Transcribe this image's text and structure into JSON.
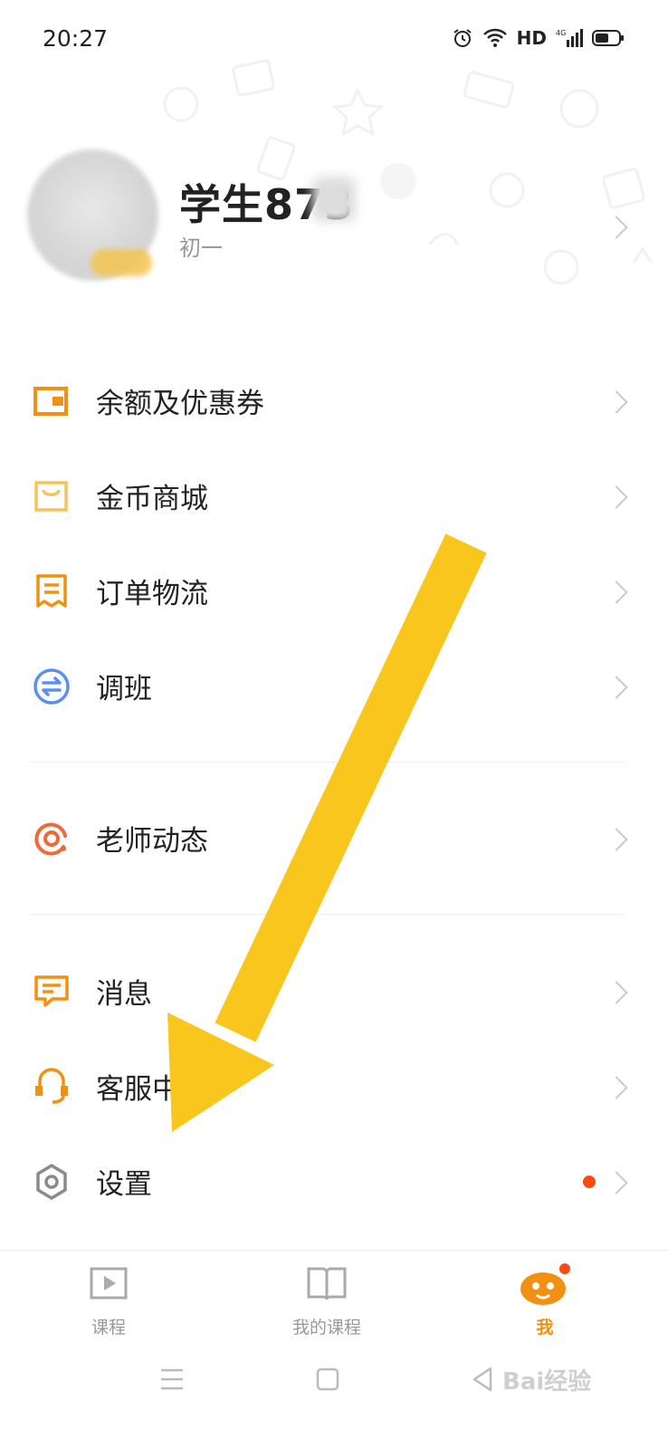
{
  "status_bar": {
    "time": "20:27",
    "network": "HD"
  },
  "profile": {
    "name": "学生873",
    "grade": "初一"
  },
  "menu": {
    "balance": "余额及优惠券",
    "coin_mall": "金币商城",
    "orders": "订单物流",
    "change_class": "调班",
    "teacher_news": "老师动态",
    "messages": "消息",
    "customer_service": "客服中",
    "settings": "设置"
  },
  "tabs": [
    {
      "label": "课程"
    },
    {
      "label": "我的课程"
    },
    {
      "label": "我"
    }
  ],
  "colors": {
    "accent": "#f29111",
    "arrow": "#f9c61e",
    "badge": "#fa4b14",
    "blue": "#5b8ff2"
  },
  "watermark": "Bai经验"
}
